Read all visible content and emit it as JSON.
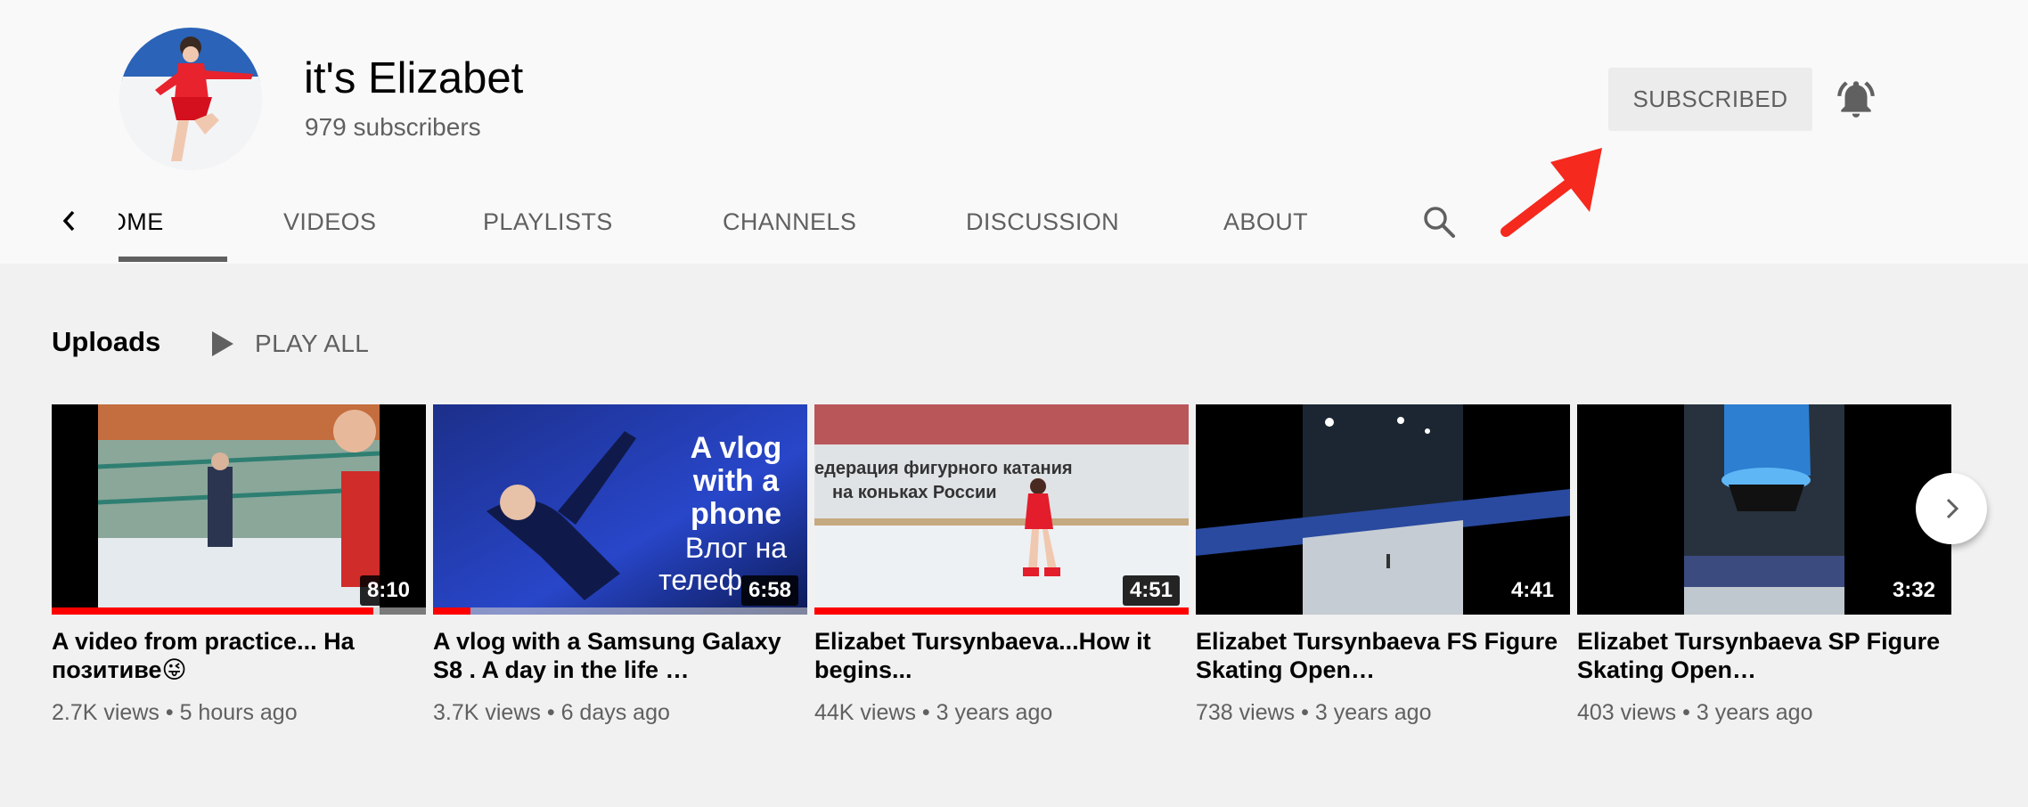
{
  "channel": {
    "name": "it's Elizabet",
    "subscribers": "979 subscribers",
    "subscribe_button": "SUBSCRIBED"
  },
  "tabs": [
    {
      "label": "HOME",
      "active": true
    },
    {
      "label": "VIDEOS",
      "active": false
    },
    {
      "label": "PLAYLISTS",
      "active": false
    },
    {
      "label": "CHANNELS",
      "active": false
    },
    {
      "label": "DISCUSSION",
      "active": false
    },
    {
      "label": "ABOUT",
      "active": false
    }
  ],
  "uploads": {
    "title": "Uploads",
    "play_all": "PLAY ALL",
    "videos": [
      {
        "title": "A video from practice... На позитиве😜",
        "meta_views": "2.7K views",
        "meta_age": "5 hours ago",
        "duration": "8:10",
        "watched_fraction": 0.86
      },
      {
        "title": "A vlog with a Samsung Galaxy S8 . A day in the life …",
        "meta_views": "3.7K views",
        "meta_age": "6 days ago",
        "duration": "6:58",
        "watched_fraction": 0.1,
        "thumb_text": [
          "A vlog",
          "with a",
          "phone",
          "Влог на",
          "телеф"
        ]
      },
      {
        "title": "Elizabet Tursynbaeva...How it begins...",
        "meta_views": "44K views",
        "meta_age": "3 years ago",
        "duration": "4:51",
        "watched_fraction": 1.0,
        "thumb_text": [
          "едерация фигурного катания",
          "на коньках России"
        ]
      },
      {
        "title": "Elizabet Tursynbaeva FS Figure Skating Open…",
        "meta_views": "738 views",
        "meta_age": "3 years ago",
        "duration": "4:41",
        "watched_fraction": 0
      },
      {
        "title": "Elizabet Tursynbaeva SP Figure Skating Open…",
        "meta_views": "403 views",
        "meta_age": "3 years ago",
        "duration": "3:32",
        "watched_fraction": 0
      }
    ]
  },
  "meta_separator": "•",
  "icons": {
    "bell": "bell-icon",
    "search": "search-icon",
    "back": "chevron-left-icon",
    "next": "chevron-right-icon",
    "play": "play-icon"
  },
  "colors": {
    "progress": "#ff0000",
    "annotation_arrow": "#f5291d"
  }
}
